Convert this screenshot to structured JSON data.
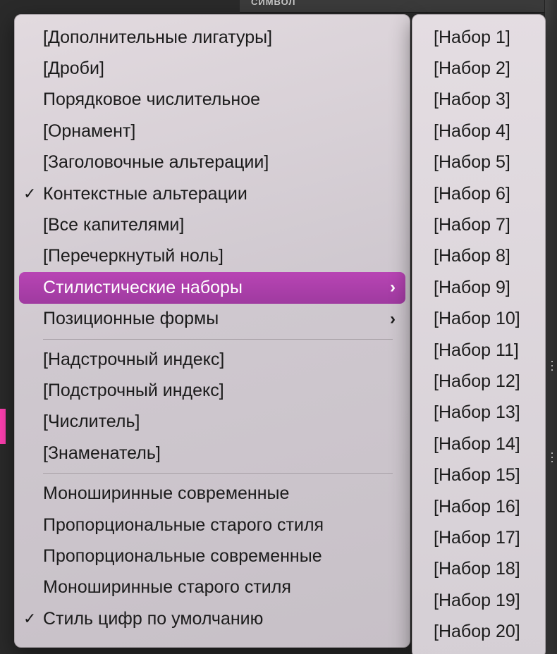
{
  "bg": {
    "panel_label": "СИМВОЛ"
  },
  "menu": {
    "items": [
      {
        "label": "[Дополнительные лигатуры]",
        "checked": false,
        "submenu": false
      },
      {
        "label": "[Дроби]",
        "checked": false,
        "submenu": false
      },
      {
        "label": "Порядковое числительное",
        "checked": false,
        "submenu": false
      },
      {
        "label": "[Орнамент]",
        "checked": false,
        "submenu": false
      },
      {
        "label": "[Заголовочные альтерации]",
        "checked": false,
        "submenu": false
      },
      {
        "label": "Контекстные альтерации",
        "checked": true,
        "submenu": false
      },
      {
        "label": "[Все капителями]",
        "checked": false,
        "submenu": false
      },
      {
        "label": "[Перечеркнутый ноль]",
        "checked": false,
        "submenu": false
      },
      {
        "label": "Стилистические наборы",
        "checked": false,
        "submenu": true,
        "selected": true
      },
      {
        "label": "Позиционные формы",
        "checked": false,
        "submenu": true
      }
    ],
    "group2": [
      {
        "label": "[Надстрочный индекс]"
      },
      {
        "label": "[Подстрочный индекс]"
      },
      {
        "label": "[Числитель]"
      },
      {
        "label": "[Знаменатель]"
      }
    ],
    "group3": [
      {
        "label": "Моноширинные современные",
        "checked": false
      },
      {
        "label": "Пропорциональные старого стиля",
        "checked": false
      },
      {
        "label": "Пропорциональные современные",
        "checked": false
      },
      {
        "label": "Моноширинные старого стиля",
        "checked": false
      },
      {
        "label": "Стиль цифр по умолчанию",
        "checked": true
      }
    ]
  },
  "submenu": {
    "items": [
      "[Набор 1]",
      "[Набор 2]",
      "[Набор 3]",
      "[Набор 4]",
      "[Набор 5]",
      "[Набор 6]",
      "[Набор 7]",
      "[Набор 8]",
      "[Набор 9]",
      "[Набор 10]",
      "[Набор 11]",
      "[Набор 12]",
      "[Набор 13]",
      "[Набор 14]",
      "[Набор 15]",
      "[Набор 16]",
      "[Набор 17]",
      "[Набор 18]",
      "[Набор 19]",
      "[Набор 20]"
    ]
  }
}
